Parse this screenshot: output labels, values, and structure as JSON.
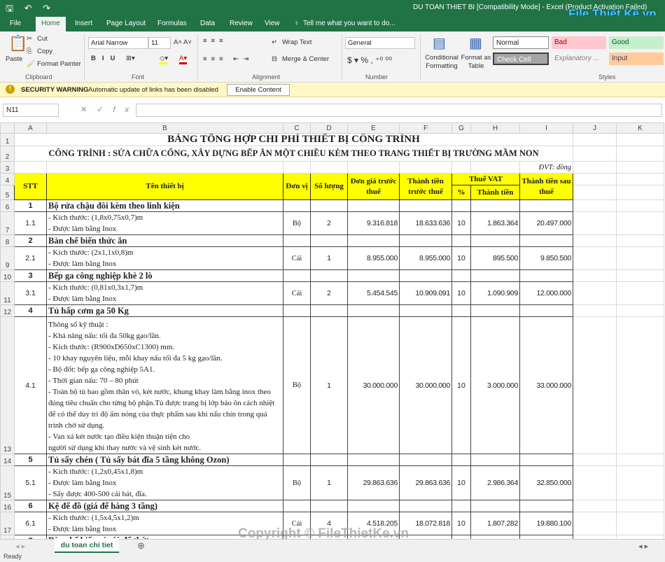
{
  "window": {
    "quick_access": "🖫 ↶ ↷",
    "title": "DU TOAN THIET BI  [Compatibility Mode] - Excel (Product Activation Failed)",
    "logo": "File Thiết Kế.vn"
  },
  "tabs": [
    "File",
    "Home",
    "Insert",
    "Page Layout",
    "Formulas",
    "Data",
    "Review",
    "View"
  ],
  "tell_me": "Tell me what you want to do...",
  "ribbon": {
    "clipboard": {
      "paste": "Paste",
      "cut": "Cut",
      "copy": "Copy",
      "format_painter": "Format Painter",
      "label": "Clipboard"
    },
    "font": {
      "name": "Arial Narrow",
      "size": "11",
      "label": "Font"
    },
    "alignment": {
      "wrap": "Wrap Text",
      "merge": "Merge & Center",
      "label": "Alignment"
    },
    "number": {
      "format": "General",
      "label": "Number"
    },
    "cond": "Conditional Formatting",
    "fmt_table": "Format as Table",
    "styles": {
      "normal": "Normal",
      "bad": "Bad",
      "good": "Good",
      "check": "Check Cell",
      "explanatory": "Explanatory ...",
      "input": "Input",
      "label": "Styles"
    }
  },
  "security": {
    "title": "SECURITY WARNING",
    "message": "Automatic update of links has been disabled",
    "button": "Enable Content"
  },
  "formula_bar": {
    "name_box": "N11",
    "value": ""
  },
  "columns": [
    "A",
    "B",
    "C",
    "D",
    "E",
    "F",
    "G",
    "H",
    "I",
    "J",
    "K"
  ],
  "sheet": {
    "title": "BẢNG TỔNG HỢP CHI PHÍ THIẾT BỊ CÔNG TRÌNH",
    "subtitle": "CÔNG TRÌNH : SỬA CHỮA CỔNG, XÂY DỰNG BẾP ĂN MỘT CHIỀU KÈM THEO TRANG THIẾT BỊ TRƯỜNG MẦM NON",
    "unit_note": "ĐVT: đồng",
    "headers": {
      "stt": "STT",
      "name": "Tên thiết bị",
      "unit": "Đơn vị",
      "qty": "Số lượng",
      "price": "Đơn giá trước thuế",
      "amount": "Thành tiền trước thuế",
      "vat": "Thuế VAT",
      "vat_pct": "%",
      "vat_amount": "Thành tiền",
      "total": "Thành tiền sau thuế"
    },
    "items": [
      {
        "stt": "1",
        "name": "Bộ rửa chậu đôi kèm theo linh kiện",
        "sub": {
          "stt": "1.1",
          "lines": [
            "- Kích thước: (1,8x0,75x0,7)m",
            "- Được làm bằng Inox"
          ],
          "unit": "Bộ",
          "qty": "2",
          "price": "9.316.818",
          "amount": "18.633.636",
          "vat_pct": "10",
          "vat_amount": "1.863.364",
          "total": "20.497.000"
        }
      },
      {
        "stt": "2",
        "name": "Bàn chế biến thức ăn",
        "sub": {
          "stt": "2.1",
          "lines": [
            "- Kích thước: (2x1,1x0,8)m",
            "- Được làm bằng Inox"
          ],
          "unit": "Cái",
          "qty": "1",
          "price": "8.955.000",
          "amount": "8.955.000",
          "vat_pct": "10",
          "vat_amount": "895.500",
          "total": "9.850.500"
        }
      },
      {
        "stt": "3",
        "name": "Bếp ga công nghiệp khè 2 lò",
        "sub": {
          "stt": "3.1",
          "lines": [
            "- Kích thước: (0,81x0,3x1,7)m",
            "- Được làm bằng Inox"
          ],
          "unit": "Cái",
          "qty": "2",
          "price": "5.454.545",
          "amount": "10.909.091",
          "vat_pct": "10",
          "vat_amount": "1.090.909",
          "total": "12.000.000"
        }
      },
      {
        "stt": "4",
        "name": "Tủ hấp cơm ga 50 Kg",
        "sub": {
          "stt": "4.1",
          "lines": [
            "Thông số kỹ thuật :",
            "- Khả năng nấu: tối đa 50kg gạo/lần.",
            "- Kích thước: (R900xD650xC1300) mm.",
            "- 10 khay nguyên liệu, mỗi khay nấu tối đa 5 kg gạo/lần.",
            "- Bộ đốt: bếp ga công nghiệp 5A1.",
            "- Thời gian nấu: 70 – 80 phút",
            "- Toàn bộ tủ bao gồm thân vỏ, két nước, khung khay làm bằng inox theo đúng tiêu chuẩn cho từng bộ phận.Tủ được trang bị lớp bảo ôn cách nhiệt để có thể duy trì độ ấm nóng của thực phẩm sau khi nấu chín trong quá trình chờ sử dụng.",
            "- Van xả két nước tạo điều kiện thuận tiện cho",
            " người sử dụng khi thay nước và vệ sinh két nước."
          ],
          "unit": "Bộ",
          "qty": "1",
          "price": "30.000.000",
          "amount": "30.000.000",
          "vat_pct": "10",
          "vat_amount": "3.000.000",
          "total": "33.000.000"
        }
      },
      {
        "stt": "5",
        "name": "Tủ sấy chén ( Tủ sấy bát đĩa 5 tầng không Ozon)",
        "sub": {
          "stt": "5.1",
          "lines": [
            "- Kích thước: (1,2x0,45x1,8)m",
            "- Được làm bằng Inox",
            "- Sấy được 400-500 cái bát, đĩa."
          ],
          "unit": "Bộ",
          "qty": "1",
          "price": "29.863.636",
          "amount": "29.863.636",
          "vat_pct": "10",
          "vat_amount": "2.986.364",
          "total": "32.850.000"
        }
      },
      {
        "stt": "6",
        "name": "Kệ để đồ (giá để hàng 3 tầng)",
        "sub": {
          "stt": "6.1",
          "lines": [
            "- Kích thước: (1,5x4,5x1,2)m",
            "- Được làm bằng Inox"
          ],
          "unit": "Cái",
          "qty": "4",
          "price": "4.518.205",
          "amount": "18.072.818",
          "vat_pct": "10",
          "vat_amount": "1.807.282",
          "total": "19.880.100"
        }
      },
      {
        "stt": "7",
        "name": "Bàn chế biến có giá để thớt"
      }
    ]
  },
  "sheet_tab": "du toan chi tiet",
  "status": "Ready",
  "watermark": "Copyright © FileThietKe.vn"
}
